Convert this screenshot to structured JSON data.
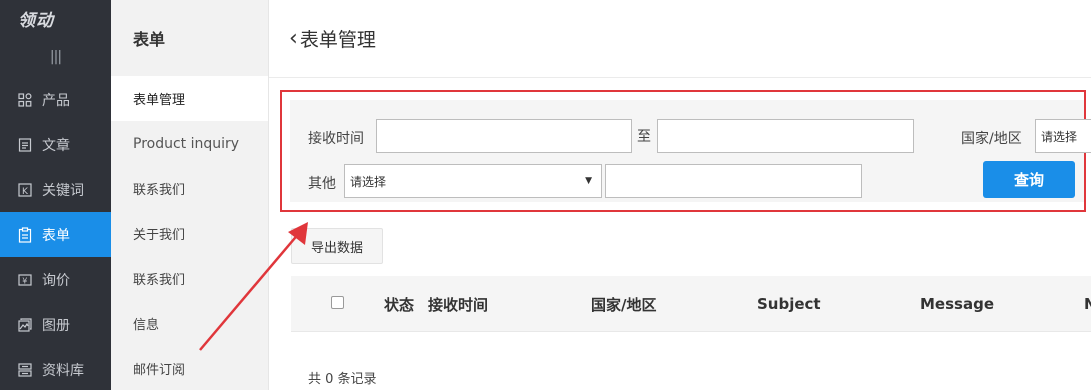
{
  "nav": {
    "logo_text": "领动",
    "collapse_icon": "|||",
    "items": [
      {
        "label": "产品",
        "icon": "grid-icon"
      },
      {
        "label": "文章",
        "icon": "document-icon"
      },
      {
        "label": "关键词",
        "icon": "k-icon"
      },
      {
        "label": "表单",
        "icon": "clipboard-icon",
        "active": true
      },
      {
        "label": "询价",
        "icon": "yen-icon"
      },
      {
        "label": "图册",
        "icon": "gallery-icon"
      },
      {
        "label": "资料库",
        "icon": "database-icon"
      }
    ]
  },
  "submenu": {
    "title": "表单",
    "items": [
      "表单管理",
      "Product inquiry",
      "联系我们",
      "关于我们",
      "联系我们",
      "信息",
      "邮件订阅"
    ]
  },
  "header": {
    "back_icon": "‹",
    "title": "表单管理"
  },
  "filter": {
    "receive_time_label": "接收时间",
    "to_label": "至",
    "country_label": "国家/地区",
    "country_select": "请选择",
    "other_label": "其他",
    "other_select": "请选择",
    "query_button": "查询"
  },
  "export_button": "导出数据",
  "table": {
    "columns": [
      "状态",
      "接收时间",
      "国家/地区",
      "Subject",
      "Message",
      "N"
    ]
  },
  "records_text": "共 0 条记录",
  "colors": {
    "accent": "#1a8ee8",
    "highlight_border": "#e0363b",
    "sidebar": "#2f3239"
  }
}
